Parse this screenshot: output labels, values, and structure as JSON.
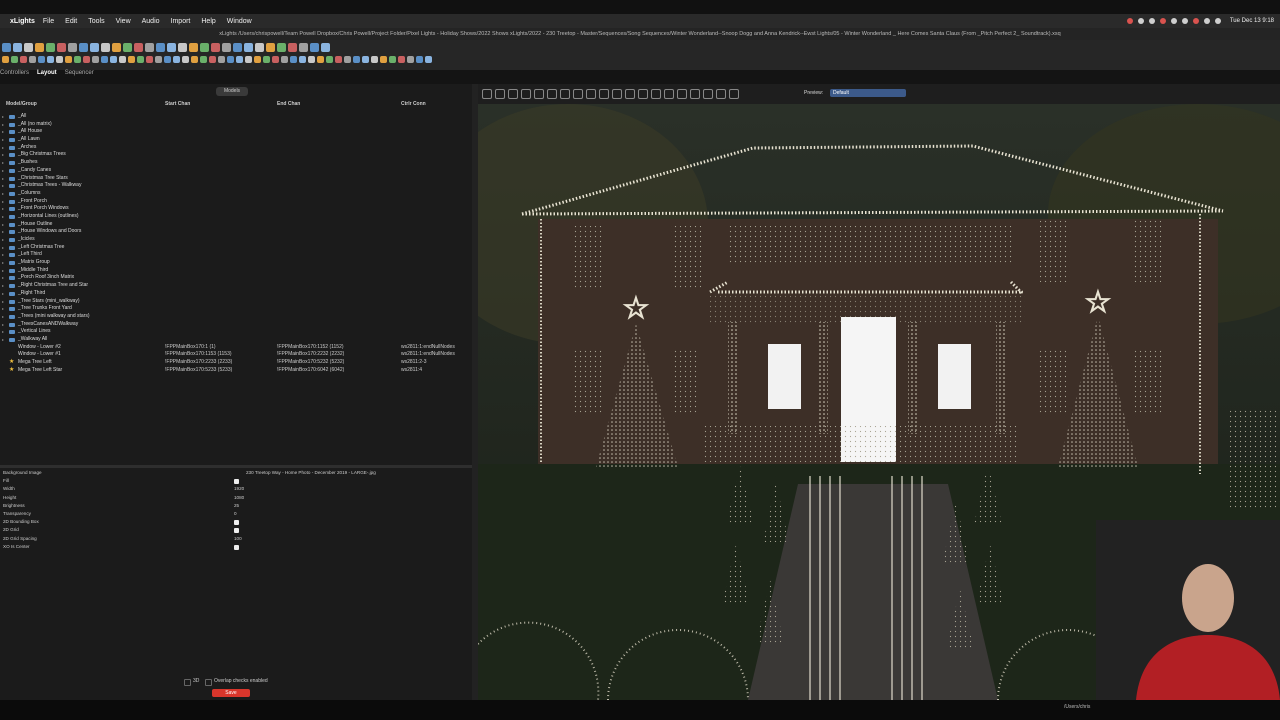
{
  "menubar": {
    "app": "xLights",
    "items": [
      "File",
      "Edit",
      "Tools",
      "View",
      "Audio",
      "Import",
      "Help",
      "Window"
    ],
    "clock": "Tue Dec 13  9:18"
  },
  "window": {
    "title": "xLights /Users/chrispowell/Team Powell Dropbox/Chris Powell/Project Folder/Pixel Lights - Holiday Shows/2022 Shows xLights/2022 - 230 Treetop - Master/Sequences/Song Sequences/Winter Wonderland--Snoop Dogg and Anna Kendrick--Ewst Lights/05 - Winter Wonderland _ Here Comes Santa Claus (From _Pitch Perfect 2_ Soundtrack).xsq"
  },
  "tabs": [
    "Controllers",
    "Layout",
    "Sequencer"
  ],
  "active_tab": "Layout",
  "left": {
    "models_button": "Models",
    "columns": [
      "Model/Group",
      "Start Chan",
      "End Chan",
      "Ctrlr Conn"
    ],
    "groups": [
      "_All",
      "_All (no matrix)",
      "_All House",
      "_All Lawn",
      "_Arches",
      "_Big Christmas Trees",
      "_Bushes",
      "_Candy Canes",
      "_Christmas Tree Stars",
      "_Christmas Trees - Walkway",
      "_Columns",
      "_Front Porch",
      "_Front Porch Windows",
      "_Horizontal Lines (outlines)",
      "_House Outline",
      "_House Windows and Doors",
      "_Icicles",
      "_Left Christmas Tree",
      "_Left Third",
      "_Matrix Group",
      "_Middle Third",
      "_Porch Roof 3inch Matrix",
      "_Right Christmas Tree and Star",
      "_Right Third",
      "_Tree Stars (mini_walkway)",
      "_Tree Trunks Front Yard",
      "_Trees (mini walkway and stars)",
      "_TreesCanesANDWalkway",
      "_Vertical Lines",
      "_Walkway All"
    ],
    "models": [
      {
        "name": "Window - Lower #2",
        "start": "!FPPMainBox170:1 (1)",
        "end": "!FPPMainBox170:1152 (1152)",
        "conn": "ws2811:1:endNullNodes"
      },
      {
        "name": "Window - Lower #1",
        "start": "!FPPMainBox170:1153 (1153)",
        "end": "!FPPMainBox170:2232 (2232)",
        "conn": "ws2811:1:endNullNodes"
      },
      {
        "name": "Mega Tree Left",
        "start": "!FPPMainBox170:2233 (2233)",
        "end": "!FPPMainBox170:5232 (5232)",
        "conn": "ws2811:2-3"
      },
      {
        "name": "Mega Tree Left Star",
        "start": "!FPPMainBox170:5233 (5233)",
        "end": "!FPPMainBox170:6042 (6042)",
        "conn": "ws2811:4"
      }
    ]
  },
  "properties": [
    {
      "name": "Background Image",
      "value": "230 Treetop Way - Home Photo - December 2019 - LARGE-.jpg",
      "type": "text"
    },
    {
      "name": "Fill",
      "value": "",
      "type": "check"
    },
    {
      "name": "Width",
      "value": "1920",
      "type": "text"
    },
    {
      "name": "Height",
      "value": "1080",
      "type": "text"
    },
    {
      "name": "Brightness",
      "value": "25",
      "type": "text"
    },
    {
      "name": "Transparency",
      "value": "0",
      "type": "text"
    },
    {
      "name": "2D Bounding Box",
      "value": "",
      "type": "check"
    },
    {
      "name": "2D Grid",
      "value": "",
      "type": "check"
    },
    {
      "name": "2D Grid Spacing",
      "value": "100",
      "type": "text"
    },
    {
      "name": "XO Is Center",
      "value": "",
      "type": "check"
    }
  ],
  "bottom": {
    "three_d_label": "3D",
    "overlap_label": "Overlap checks enabled",
    "save_label": "Save"
  },
  "preview": {
    "label": "Preview:",
    "selected": "Default"
  },
  "statusbar": {
    "path": "/Users/chris"
  },
  "colors": {
    "accent_blue": "#3c5a8a",
    "save_red": "#d8362c",
    "folder_blue": "#5a8fc6",
    "mega_star": "#f0c040"
  }
}
